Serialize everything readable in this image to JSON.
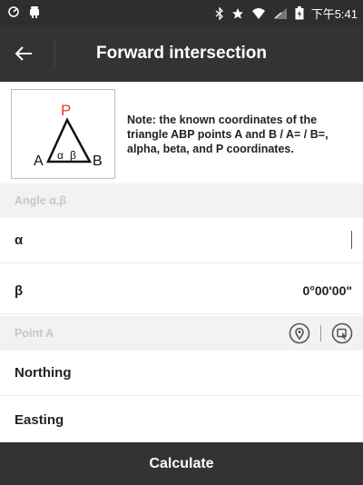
{
  "status_bar": {
    "time": "下午5:41"
  },
  "app_bar": {
    "title": "Forward intersection"
  },
  "diagram": {
    "point_p": "P",
    "point_a": "A",
    "point_b": "B",
    "alpha": "α",
    "beta": "β"
  },
  "note": {
    "text": "Note: the known coordinates of the triangle ABP points A and B / A= / B=, alpha, beta, and P coordinates."
  },
  "sections": {
    "angle": {
      "header": "Angle α,β",
      "alpha_label": "α",
      "alpha_value": "",
      "beta_label": "β",
      "beta_value": "0°00'00\""
    },
    "point_a": {
      "header": "Point A",
      "northing_label": "Northing",
      "northing_value": "",
      "easting_label": "Easting",
      "easting_value": ""
    }
  },
  "calculate_label": "Calculate",
  "colors": {
    "bar_bg": "#333333",
    "section_bg": "#f2f2f2",
    "diagram_p": "#e53935"
  }
}
